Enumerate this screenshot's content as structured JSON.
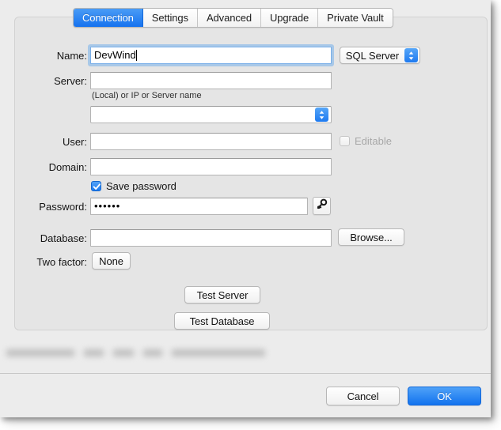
{
  "window": {
    "tabs": [
      {
        "label": "Connection",
        "selected": true
      },
      {
        "label": "Settings",
        "selected": false
      },
      {
        "label": "Advanced",
        "selected": false
      },
      {
        "label": "Upgrade",
        "selected": false
      },
      {
        "label": "Private Vault",
        "selected": false
      }
    ]
  },
  "form": {
    "name": {
      "label": "Name:",
      "value": "DevWind",
      "placeholder": "",
      "focused": true
    },
    "server_type": {
      "selected": "SQL Server"
    },
    "server": {
      "label": "Server:",
      "value": "",
      "placeholder": "",
      "hint": "(Local) or IP or Server name"
    },
    "instance": {
      "value": "",
      "placeholder": ""
    },
    "user": {
      "label": "User:",
      "value": "",
      "placeholder": ""
    },
    "editable": {
      "label": "Editable",
      "checked": false,
      "disabled": true
    },
    "domain": {
      "label": "Domain:",
      "value": "",
      "placeholder": ""
    },
    "save_password": {
      "label": "Save password",
      "checked": true
    },
    "password": {
      "label": "Password:",
      "value": "••••••",
      "placeholder": ""
    },
    "key_button": {
      "icon": "key-icon"
    },
    "database": {
      "label": "Database:",
      "value": "",
      "placeholder": ""
    },
    "browse": {
      "label": "Browse..."
    },
    "two_factor": {
      "label": "Two factor:",
      "value": "None"
    },
    "test_server": {
      "label": "Test Server"
    },
    "test_database": {
      "label": "Test Database"
    }
  },
  "footer": {
    "cancel": "Cancel",
    "ok": "OK"
  },
  "colors": {
    "accent_blue": "#1272ee",
    "selected_tab_blue": "#1572ef",
    "panel_bg": "#e5e5e5",
    "window_bg": "#ececec",
    "field_bg": "#ffffff",
    "disabled_text": "#a8a8a8"
  }
}
